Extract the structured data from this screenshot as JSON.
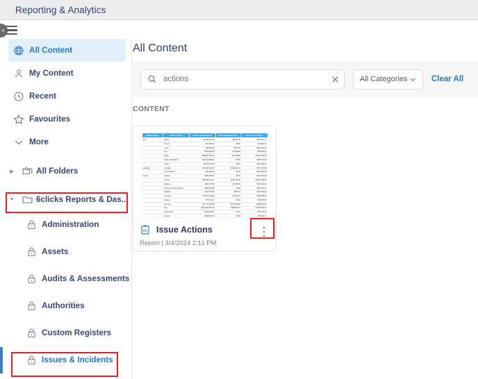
{
  "header": {
    "title": "Reporting & Analytics"
  },
  "nav": {
    "collapse_icon": "chevron-double-left-icon",
    "menu_icon": "hamburger-icon"
  },
  "sidebar": {
    "items": [
      {
        "label": "All Content",
        "icon": "globe-icon",
        "active": true
      },
      {
        "label": "My Content",
        "icon": "person-icon",
        "active": false
      },
      {
        "label": "Recent",
        "icon": "clock-icon",
        "active": false
      },
      {
        "label": "Favourites",
        "icon": "star-icon",
        "active": false
      },
      {
        "label": "More",
        "icon": "chevron-down-icon",
        "active": false
      }
    ],
    "all_folders": {
      "label": "All Folders",
      "icon": "folders-icon",
      "caret": "caret-right-icon"
    },
    "current_folder": {
      "label": "6clicks Reports & Das...",
      "icon": "folder-icon",
      "caret": "caret-down-icon"
    },
    "subfolders": [
      {
        "label": "Administration",
        "icon": "lock-icon",
        "selected": false
      },
      {
        "label": "Assets",
        "icon": "lock-icon",
        "selected": false
      },
      {
        "label": "Audits & Assessments",
        "icon": "lock-icon",
        "selected": false
      },
      {
        "label": "Authorities",
        "icon": "lock-icon",
        "selected": false
      },
      {
        "label": "Custom Registers",
        "icon": "lock-icon",
        "selected": false
      },
      {
        "label": "Issues & Incidents",
        "icon": "lock-icon",
        "selected": true
      }
    ]
  },
  "main": {
    "page_title": "All Content",
    "search": {
      "value": "actions",
      "placeholder": "Search",
      "icon": "search-icon",
      "clear_icon": "close-icon"
    },
    "category_filter": {
      "value": "All Categories",
      "icon": "chevron-down-icon"
    },
    "clear_all_label": "Clear All",
    "section_label": "CONTENT"
  },
  "card": {
    "title": "Issue Actions",
    "icon": "report-clipboard-icon",
    "type": "Report",
    "separator": "|",
    "date": "3/4/2024 2:11 PM",
    "menu_icon": "kebab-menu-icon",
    "thumbnail": {
      "headers": [
        "Athlete Region",
        "Athlete Country",
        "Sum Invoiced Amount",
        "Sum Cancellation Fee",
        "Sum Cost of Comp"
      ],
      "rows": [
        [
          "Asia",
          "China",
          "$3,289,211.92",
          "$8,322.91",
          "$760,821.71"
        ],
        [
          "",
          "Cyprus",
          "$47,386.32",
          "$0.00",
          "$42,519.07"
        ],
        [
          "",
          "India",
          "$36,823.84",
          "$672.90",
          "$231,534.21"
        ],
        [
          "",
          "Iran",
          "$132,891.93",
          "$2,193.88",
          "$82,901.22"
        ],
        [
          "",
          "Japan",
          "$68,987,544.08",
          "$29,199.08",
          "$5,182,346.83"
        ],
        [
          "",
          "Korea, Republic of",
          "$61,192,883.20",
          "$0.00",
          "$788,072.10"
        ],
        [
          "",
          "Turkey",
          "$8,219,379.90",
          "$0.00",
          "$120,990.68"
        ],
        [
          "Australia",
          "Australia",
          "$13,902,028.00",
          "$198,214.42",
          "$786,773.08"
        ],
        [
          "",
          "New Zealand",
          "$96,091.93",
          "$0.00",
          "$949,946.38"
        ],
        [
          "Europe",
          "Andorra",
          "$255,428.40",
          "$0.00",
          "$174,029.08"
        ],
        [
          "",
          "Austria",
          "$68,448,019.11",
          "$929,140.28",
          "$3,087,098.69"
        ],
        [
          "",
          "Belgium",
          "$298,779.98",
          "$2,187.78",
          "$180,182.22"
        ],
        [
          "",
          "Bosnia and Herzegovina",
          "$290,028.92",
          "$0.00",
          "$227,081.03"
        ],
        [
          "",
          "Bulgaria",
          "$212,387.98",
          "$982.03",
          "$178,901.08"
        ],
        [
          "",
          "Denmark",
          "$2,874,998.90",
          "$1,291.03",
          "$328,988.30"
        ],
        [
          "",
          "Finland",
          "$75,471.41",
          "$0.00",
          "$79,079.08"
        ],
        [
          "",
          "Germany",
          "$12,777,218.80",
          "$149,984.98",
          "$809,087.08"
        ],
        [
          "",
          "Italy",
          "$103,802,087.37",
          "$198,222.70",
          "$7,990,902.07"
        ],
        [
          "",
          "Netherlands",
          "$928,089.92",
          "$0.00",
          "$87,240.09"
        ],
        [
          "",
          "Norway",
          "$928,291.98",
          "$0.00",
          "$79,940.13"
        ]
      ]
    }
  },
  "annotations": {
    "boxes": [
      {
        "name": "current-folder-highlight"
      },
      {
        "name": "issues-incidents-highlight"
      },
      {
        "name": "card-menu-highlight"
      }
    ],
    "color": "#ee1c25"
  }
}
